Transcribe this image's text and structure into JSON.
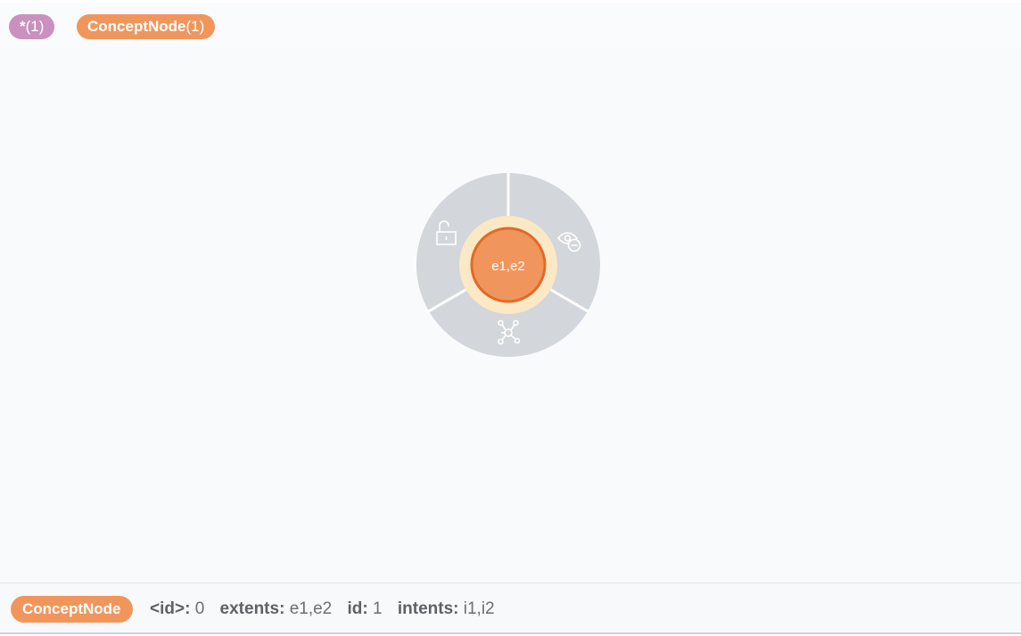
{
  "legend": {
    "all_label": "*",
    "all_count": "(1)",
    "concept_label": "ConceptNode",
    "concept_count": "(1)"
  },
  "node": {
    "caption": "e1,e2",
    "menu_icons": [
      "lock-open-icon",
      "hide-icon",
      "expand-icon"
    ]
  },
  "status": {
    "label": "ConceptNode",
    "properties": [
      {
        "key": "<id>:",
        "value": "0"
      },
      {
        "key": "extents:",
        "value": "e1,e2"
      },
      {
        "key": "id:",
        "value": "1"
      },
      {
        "key": "intents:",
        "value": "i1,i2"
      }
    ]
  },
  "colors": {
    "all_pill": "#c990c0",
    "concept_pill": "#f0965c",
    "node_fill": "#f0965c",
    "node_stroke": "#e06a28",
    "halo": "#fbe8c4",
    "ring": "#d3d6da"
  }
}
